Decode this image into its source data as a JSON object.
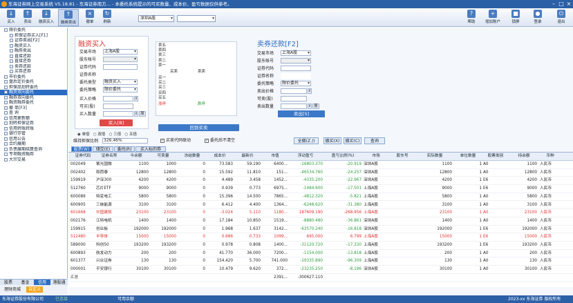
{
  "title": "东海证券网上交易系统 V5.18.81 - 东海证券南方... - 本委托系统提示的可买数量、成本价、盈亏数据仅供参考。",
  "toolbar": {
    "buttons": [
      {
        "id": "buy",
        "label": "买入"
      },
      {
        "id": "sell",
        "label": "卖出"
      },
      {
        "id": "margin_buy",
        "label": "融资买入"
      },
      {
        "id": "margin_sell",
        "label": "融券卖出"
      },
      {
        "id": "cancel",
        "label": "撤单"
      },
      {
        "id": "refresh",
        "label": "刷新"
      }
    ],
    "right": [
      {
        "id": "help",
        "label": "帮助"
      },
      {
        "id": "add_account",
        "label": "增加账户"
      },
      {
        "id": "lock",
        "label": "锁屏"
      },
      {
        "id": "login",
        "label": "登录"
      },
      {
        "id": "exit",
        "label": "退出"
      }
    ],
    "market": "深圳A股",
    "account": ""
  },
  "sidebar": {
    "items": [
      {
        "label": "限价委托",
        "level": 0
      },
      {
        "label": "担保证券买入[F1]",
        "level": 1
      },
      {
        "label": "证券卖出[F2]",
        "level": 1
      },
      {
        "label": "融资买入",
        "level": 1
      },
      {
        "label": "融券卖出",
        "level": 1
      },
      {
        "label": "直接还款",
        "level": 1
      },
      {
        "label": "直接还券",
        "level": 1
      },
      {
        "label": "卖券还款",
        "level": 1
      },
      {
        "label": "买券还券",
        "level": 1
      },
      {
        "label": "市价委托",
        "level": 0
      },
      {
        "label": "盘后定价委托",
        "level": 0
      },
      {
        "label": "担保品划转委托",
        "level": 0
      },
      {
        "label": "融资双向委托",
        "level": 0,
        "selected": true
      },
      {
        "label": "融券双向委托",
        "level": 0
      },
      {
        "label": "融资融券委托",
        "level": 0
      },
      {
        "label": "撤  单[F3]",
        "level": 0
      },
      {
        "label": "查    询",
        "level": 0
      },
      {
        "label": "信用更新额",
        "level": 0
      },
      {
        "label": "划转担保证券",
        "level": 0
      },
      {
        "label": "信用转账转账",
        "level": 0
      },
      {
        "label": "银行存管",
        "level": 0
      },
      {
        "label": "信用公告",
        "level": 0
      },
      {
        "label": "合约展期",
        "level": 0
      },
      {
        "label": "负债展期结算查询",
        "level": 0
      },
      {
        "label": "专项融资融券",
        "level": 0
      },
      {
        "label": "大宗交易",
        "level": 0
      }
    ],
    "bottom_tabs": [
      "股票",
      "基金",
      "信用",
      "港股通"
    ],
    "bottom_buttons": [
      "理财商城",
      "自定义"
    ]
  },
  "buy_panel": {
    "title": "融资买入",
    "market_label": "交易市场",
    "market": "上海A股",
    "holder_label": "股东帐号",
    "holder": "",
    "code_label": "证券代码",
    "code": "",
    "name_label": "证券名称",
    "name": "",
    "type_label": "委托类型",
    "type": "融资买入",
    "strategy_label": "委托策略",
    "strategy": "限价委托",
    "price_label": "买入价格",
    "price": "",
    "max_label": "可买(股)",
    "max": "",
    "qty_label": "买入数量",
    "qty": "",
    "unit_btn": "股",
    "submit": "买入[B]",
    "radios": [
      "单倍",
      "双倍",
      "三倍",
      "五倍"
    ],
    "ratio_label": "维持担保比例",
    "ratio": "326.46%"
  },
  "orderbook": {
    "sell": [
      "卖五",
      "卖四",
      "卖三",
      "卖二",
      "卖一"
    ],
    "buy": [
      "买一",
      "买二",
      "买三",
      "买四",
      "买五"
    ],
    "mid": [
      "买卖",
      "卖卖"
    ],
    "footer": [
      "涨停",
      "跌停"
    ],
    "reset": "回到买卖"
  },
  "sell_panel": {
    "title": "卖券还款[F2]",
    "market_label": "交易市场",
    "market": "上海A股",
    "holder_label": "股东帐号",
    "holder": "",
    "code_label": "证券代码",
    "code": "",
    "name_label": "证券名称",
    "name": "",
    "strategy_label": "委托策略",
    "strategy": "限价委托",
    "price_label": "卖出价格",
    "price": "",
    "max_label": "可卖(股)",
    "max": "",
    "qty_label": "卖出数量",
    "qty": "",
    "unit_btn": "股",
    "submit": "卖出[S]"
  },
  "options": {
    "linked": "买卖代码联动",
    "keep": "委托后不清空"
  },
  "actions": [
    "全撤(Z /)",
    "撤买(X)",
    "撤买(C)",
    "查询"
  ],
  "grid_tabs": [
    "股票(W)",
    "储交(E)",
    "委托(R)",
    "买入标的券"
  ],
  "table": {
    "columns": [
      "证券代码",
      "证券名称",
      "今余额",
      "可卖量",
      "冻结数量",
      "成本价",
      "最新价",
      "市值",
      "浮动盈亏",
      "盈亏比例(%)",
      "市场",
      "股东号",
      "实际数量",
      "单位数量",
      "股票类别",
      "持余额",
      "币种"
    ],
    "rows": [
      [
        "002049",
        "紫光国微",
        "1100",
        "1000",
        "0",
        "73.583",
        "59.190",
        "6400...",
        "-16803.370",
        "-20.919",
        "深圳A股",
        "",
        "1100",
        "1",
        "A0",
        "1100",
        "人民币"
      ],
      [
        "002402",
        "和而泰",
        "12800",
        "12800",
        "0",
        "15.592",
        "11.810",
        "151...",
        "-46534.760",
        "-24.257",
        "深圳A股",
        "",
        "12800",
        "1",
        "A0",
        "12800",
        "人民币"
      ],
      [
        "159919",
        "沪深300",
        "4200",
        "4200",
        "0",
        "4.489",
        "3.458",
        "1452...",
        "-4335.200",
        "-22.967",
        "深圳A股",
        "",
        "4200",
        "1",
        "E6",
        "4200",
        "人民币"
      ],
      [
        "512760",
        "芯片ETF",
        "9000",
        "9000",
        "0",
        "0.939",
        "0.773",
        "6975...",
        "-1484.600",
        "-17.501",
        "上海A股",
        "",
        "9000",
        "1",
        "E6",
        "9000",
        "人民币"
      ],
      [
        "600089",
        "特变电工",
        "5800",
        "5800",
        "0",
        "15.396",
        "14.500",
        "7865...",
        "-4812.320",
        "-5.821",
        "上海A股",
        "",
        "5800",
        "1",
        "A0",
        "5800",
        "人民币"
      ],
      [
        "600905",
        "三峡能源",
        "3100",
        "3100",
        "0",
        "6.412",
        "4.400",
        "1364...",
        "-6248.620",
        "-31.380",
        "上海A股",
        "",
        "3100",
        "1",
        "A0",
        "3100",
        "人民币"
      ],
      [
        "601668",
        "中国建筑",
        "23100",
        "23100",
        "0",
        "-3.024",
        "5.110",
        "1180...",
        "187609.190",
        "-268.956",
        "上海A股",
        "",
        "23100",
        "1",
        "A0",
        "23100",
        "人民币"
      ],
      [
        "002176",
        "江特电机",
        "1400",
        "1400",
        "0",
        "17.184",
        "10.850",
        "1519...",
        "-8880.480",
        "-36.861",
        "深圳A股",
        "",
        "1400",
        "1",
        "A0",
        "1400",
        "人民币"
      ],
      [
        "159915",
        "创业板",
        "192000",
        "192000",
        "0",
        "1.968",
        "1.637",
        "3142...",
        "-63570.240",
        "-16.818",
        "深圳A股",
        "",
        "192000",
        "1",
        "E6",
        "192000",
        "人民币"
      ],
      [
        "512480",
        "半导体",
        "15000",
        "15000",
        "0",
        "0.686",
        "0.733",
        "1099...",
        "695.000",
        "6.799",
        "上海A股",
        "",
        "15000",
        "1",
        "E6",
        "15000",
        "人民币"
      ],
      [
        "589000",
        "科创50",
        "193200",
        "193200",
        "0",
        "0.978",
        "0.808",
        "1400...",
        "-31120.720",
        "-17.330",
        "上海A股",
        "",
        "193200",
        "1",
        "E6",
        "193200",
        "人民币"
      ],
      [
        "600893",
        "航发动力",
        "200",
        "200",
        "0",
        "41.770",
        "36.000",
        "7200...",
        "-1154.000",
        "-13.818",
        "上海A股",
        "",
        "200",
        "1",
        "A0",
        "200",
        "人民币"
      ],
      [
        "601377",
        "兴业证券",
        "130",
        "130",
        "0",
        "154.420",
        "5.700",
        "741.000",
        "-19335.890",
        "-96.309",
        "上海A股",
        "",
        "130",
        "1",
        "A0",
        "130",
        "人民币"
      ],
      [
        "000001",
        "平安银行",
        "30100",
        "30100",
        "0",
        "10.479",
        "9.620",
        "372...",
        "-23235.250",
        "-8.196",
        "深圳A股",
        "",
        "30100",
        "1",
        "A0",
        "30100",
        "人民币"
      ]
    ],
    "red_rows": [
      6,
      9
    ],
    "summary": {
      "label": "汇总",
      "market_value": "2391...",
      "pnl": "-300627.110"
    }
  },
  "status": {
    "company": "东海证券股份有限公司",
    "indicator": "已连接",
    "message": "可用余额",
    "right": "2023-xx 东海证券 版权所有"
  }
}
